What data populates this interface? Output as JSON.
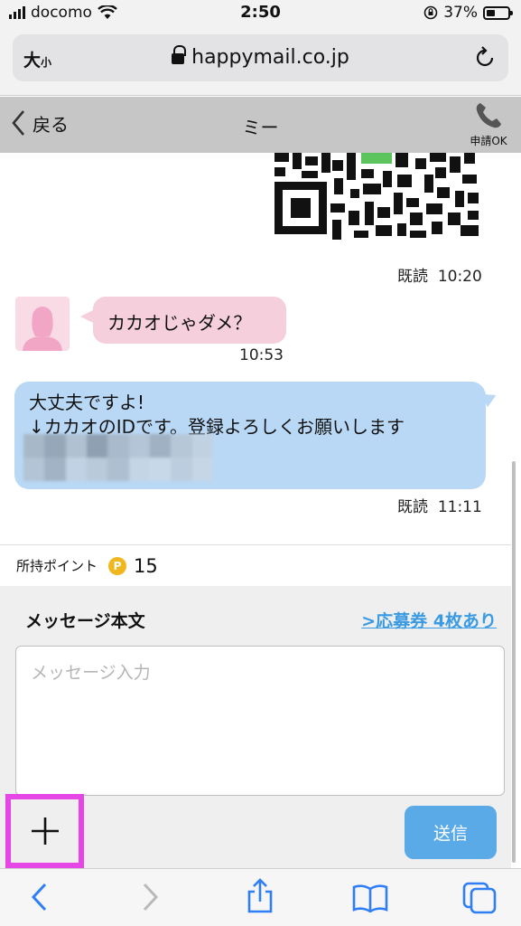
{
  "status_bar": {
    "carrier": "docomo",
    "time": "2:50",
    "battery": "37%"
  },
  "browser": {
    "text_size_big": "大",
    "text_size_small": "小",
    "url": "happymail.co.jp"
  },
  "header": {
    "back_label": "戻る",
    "title": "ミー",
    "call_label": "申請OK"
  },
  "chat": {
    "qr_read": "既読",
    "qr_time": "10:20",
    "incoming_text": "カカオじゃダメ？",
    "incoming_time": "10:53",
    "outgoing_line1": "大丈夫ですよ!",
    "outgoing_line2": "↓カカオのIDです。登録よろしくお願いします",
    "outgoing_read": "既読",
    "outgoing_time": "11:11"
  },
  "points": {
    "label": "所持ポイント",
    "coin": "P",
    "value": "15"
  },
  "composer": {
    "title": "メッセージ本文",
    "ticket_link": ">応募券 4枚あり",
    "placeholder": "メッセージ入力",
    "send_label": "送信"
  },
  "colors": {
    "pink_bubble": "#f5cfdc",
    "blue_bubble": "#b9d8f5",
    "send_button": "#5aaae8",
    "highlight": "#e646e6",
    "link": "#3a9be3"
  }
}
